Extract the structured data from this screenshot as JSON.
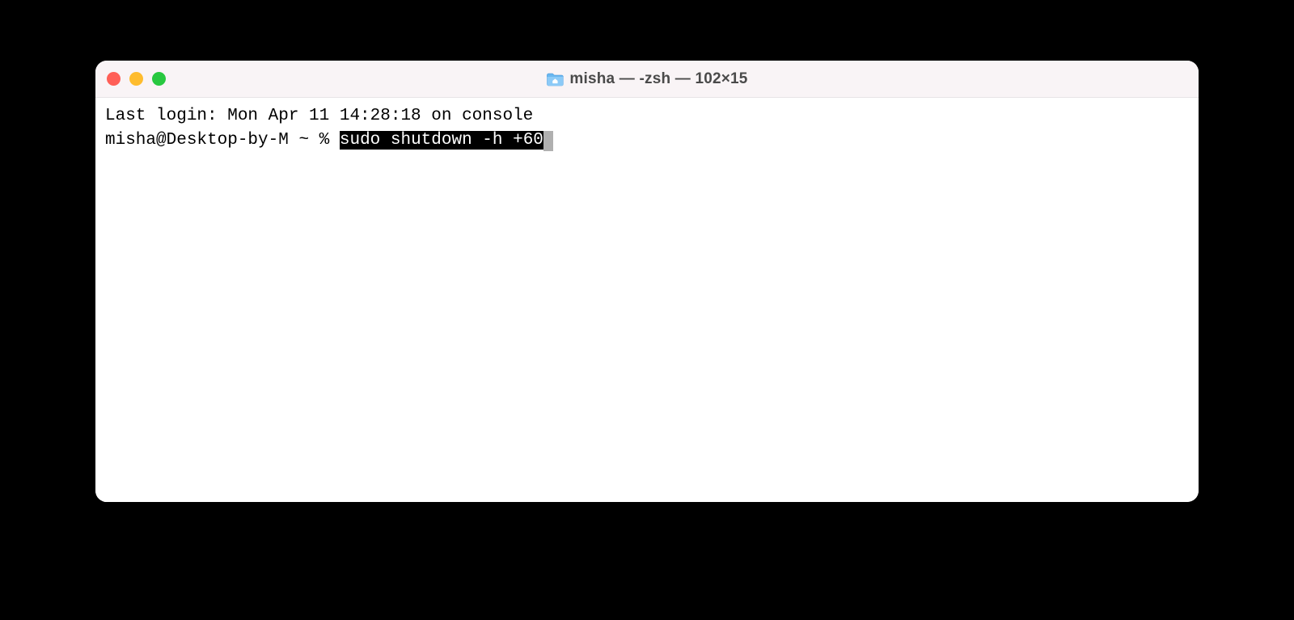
{
  "window": {
    "title": "misha — -zsh — 102×15",
    "icon": "home-folder-icon"
  },
  "terminal": {
    "last_login_line": "Last login: Mon Apr 11 14:28:18 on console",
    "prompt": "misha@Desktop-by-M ~ % ",
    "command_selected": "sudo shutdown -h +60"
  }
}
